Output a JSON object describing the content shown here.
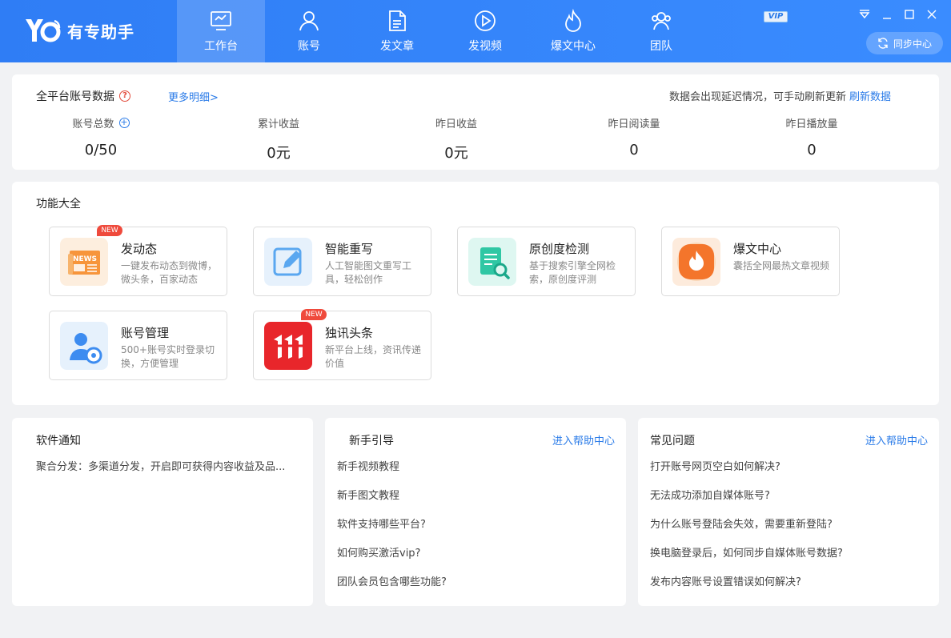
{
  "app": {
    "name": "有专助手"
  },
  "nav": [
    {
      "label": "工作台",
      "icon": "monitor-icon",
      "active": true
    },
    {
      "label": "账号",
      "icon": "user-icon"
    },
    {
      "label": "发文章",
      "icon": "document-icon"
    },
    {
      "label": "发视频",
      "icon": "play-icon"
    },
    {
      "label": "爆文中心",
      "icon": "fire-icon"
    },
    {
      "label": "团队",
      "icon": "team-icon"
    }
  ],
  "vip_label": "VIP",
  "sync_label": "同步中心",
  "stats": {
    "title": "全平台账号数据",
    "more": "更多明细>",
    "notice": "数据会出现延迟情况，可手动刷新更新",
    "refresh": "刷新数据",
    "items": [
      {
        "label": "账号总数",
        "value": "0/50"
      },
      {
        "label": "累计收益",
        "value": "0元"
      },
      {
        "label": "昨日收益",
        "value": "0元"
      },
      {
        "label": "昨日阅读量",
        "value": "0"
      },
      {
        "label": "昨日播放量",
        "value": "0"
      }
    ]
  },
  "features": {
    "title": "功能大全",
    "items": [
      {
        "title": "发动态",
        "desc": "一键发布动态到微博，微头条，百家动态",
        "badge": "NEW",
        "icon": "news-icon"
      },
      {
        "title": "智能重写",
        "desc": "人工智能图文重写工具，轻松创作",
        "icon": "edit-icon"
      },
      {
        "title": "原创度检测",
        "desc": "基于搜索引擎全网检索，原创度评测",
        "icon": "search-doc-icon"
      },
      {
        "title": "爆文中心",
        "desc": "囊括全网最热文章视频",
        "icon": "fire-icon"
      },
      {
        "title": "账号管理",
        "desc": "500+账号实时登录切换，方便管理",
        "icon": "user-settings-icon"
      },
      {
        "title": "独讯头条",
        "desc": "新平台上线，资讯传递价值",
        "badge": "NEW",
        "icon": "toutiao-icon"
      }
    ]
  },
  "panels": {
    "notice": {
      "title": "软件通知",
      "items": [
        "聚合分发：多渠道分发，开启即可获得内容收益及品..."
      ]
    },
    "guide": {
      "title": "新手引导",
      "link": "进入帮助中心",
      "items": [
        "新手视频教程",
        "新手图文教程",
        "软件支持哪些平台?",
        "如何购买激活vip?",
        "团队会员包含哪些功能?"
      ]
    },
    "faq": {
      "title": "常见问题",
      "link": "进入帮助中心",
      "items": [
        "打开账号网页空白如何解决?",
        "无法成功添加自媒体账号?",
        "为什么账号登陆会失效，需要重新登陆?",
        "换电脑登录后，如何同步自媒体账号数据?",
        "发布内容账号设置错误如何解决?"
      ]
    }
  }
}
